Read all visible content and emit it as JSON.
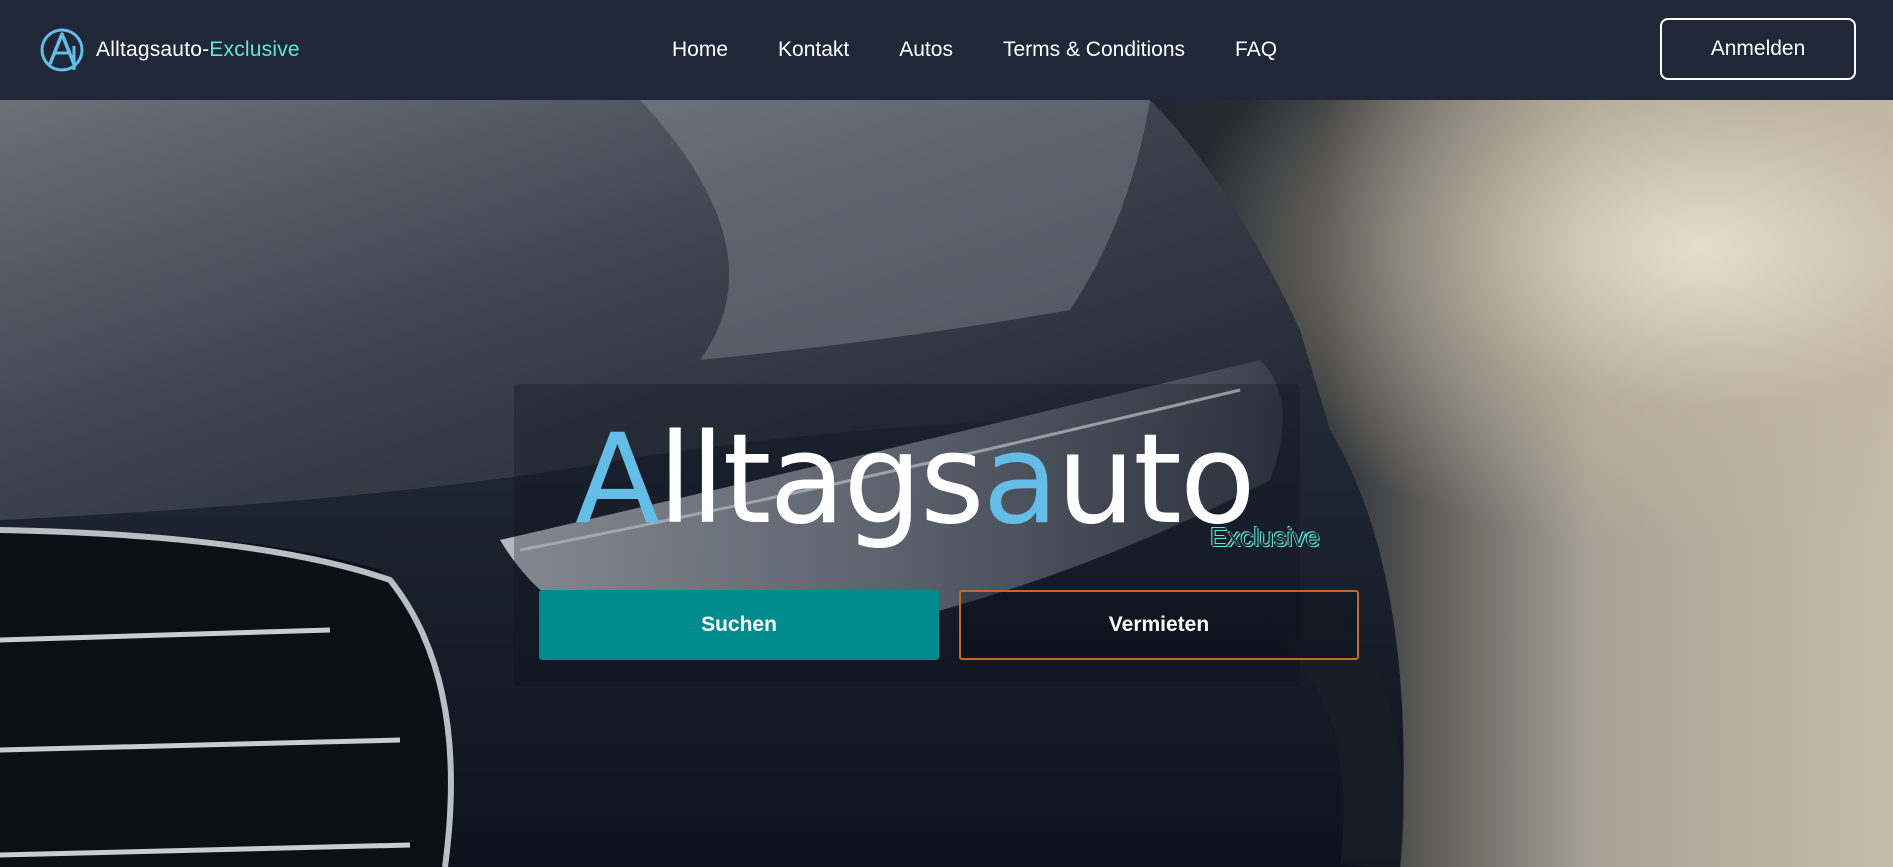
{
  "header": {
    "brand_text": "Alltagsauto-",
    "brand_accent": "Exclusive",
    "nav": [
      {
        "label": "Home"
      },
      {
        "label": "Kontakt"
      },
      {
        "label": "Autos"
      },
      {
        "label": "Terms & Conditions"
      },
      {
        "label": "FAQ"
      }
    ],
    "login_label": "Anmelden"
  },
  "hero": {
    "logo_part1": "A",
    "logo_part2": "lltags",
    "logo_part3": "a",
    "logo_part4": "uto",
    "logo_sub": "Exclusive",
    "search_label": "Suchen",
    "rent_label": "Vermieten"
  },
  "colors": {
    "navbar_bg": "#1f2738",
    "accent_teal": "#008b8f",
    "logo_blue": "#63bde6",
    "brand_accent": "#5eead4",
    "rent_border": "#c46a1d"
  },
  "icons": {
    "brand_logo": "alltagsauto-logo-icon"
  }
}
